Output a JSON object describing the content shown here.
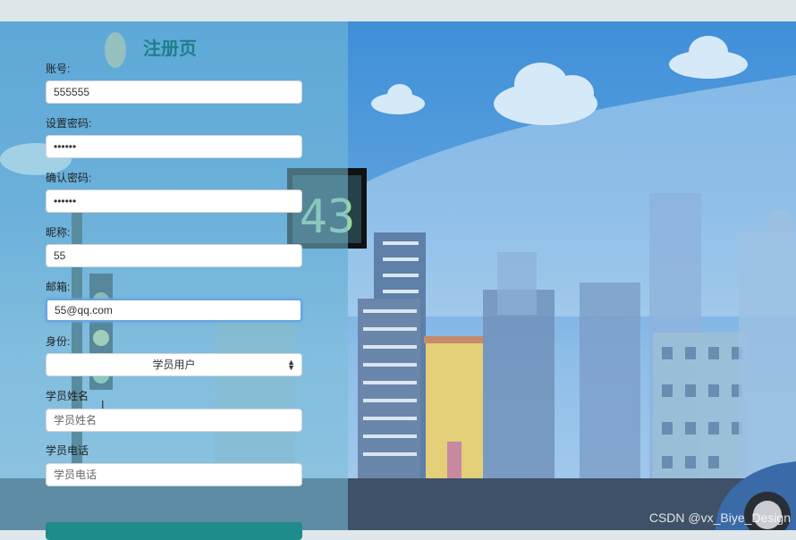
{
  "form": {
    "title": "注册页",
    "account_label": "账号:",
    "account_value": "555555",
    "password_label": "设置密码:",
    "password_value": "555555",
    "confirm_label": "确认密码:",
    "confirm_value": "555555",
    "nickname_label": "昵称:",
    "nickname_value": "55",
    "email_label": "邮箱:",
    "email_value": "55@qq.com",
    "role_label": "身份:",
    "role_value": "学员用户",
    "student_name_label": "学员姓名",
    "student_name_placeholder": "学员姓名",
    "student_phone_label": "学员电话",
    "student_phone_placeholder": "学员电话"
  },
  "background": {
    "sign_number": "43",
    "watermark": "CSDN @vx_Biye_Design"
  },
  "colors": {
    "title": "#1f7f8a",
    "submit": "#1f8c8c",
    "panel": "#78bed7"
  }
}
